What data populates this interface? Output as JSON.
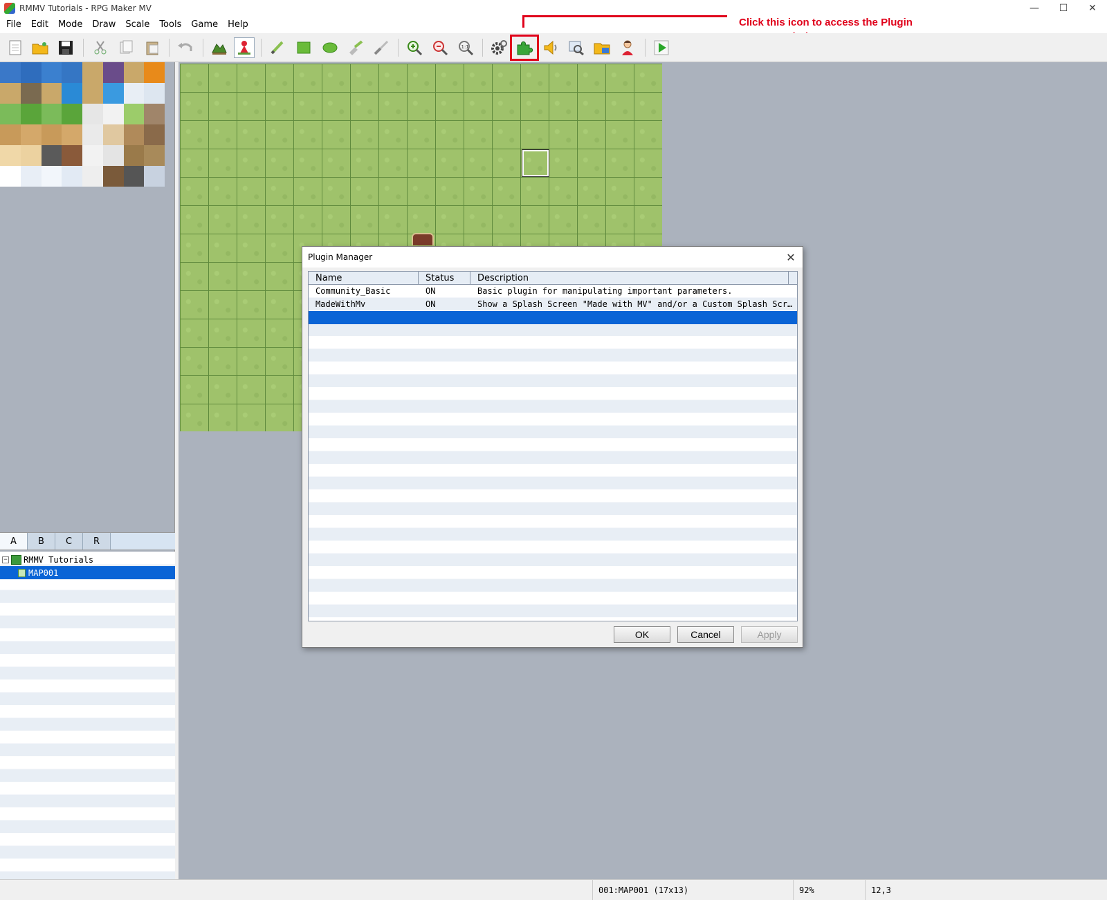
{
  "window": {
    "title": "RMMV Tutorials - RPG Maker MV",
    "minimize": "—",
    "maximize": "☐",
    "close": "✕"
  },
  "menu": [
    {
      "label": "File"
    },
    {
      "label": "Edit"
    },
    {
      "label": "Mode"
    },
    {
      "label": "Draw"
    },
    {
      "label": "Scale"
    },
    {
      "label": "Tools"
    },
    {
      "label": "Game"
    },
    {
      "label": "Help"
    }
  ],
  "annotation": {
    "text": "Click this icon to access the Plugin Manager window",
    "color": "#e0001a"
  },
  "tileset_tabs": [
    {
      "label": "A"
    },
    {
      "label": "B"
    },
    {
      "label": "C"
    },
    {
      "label": "R"
    }
  ],
  "map_tree": {
    "project": "RMMV Tutorials",
    "map": "MAP001"
  },
  "status": {
    "map_info": "001:MAP001 (17x13)",
    "zoom": "92%",
    "coords": "12,3"
  },
  "plugin_manager": {
    "title": "Plugin Manager",
    "columns": {
      "name": "Name",
      "status": "Status",
      "description": "Description"
    },
    "rows": [
      {
        "name": "Community_Basic",
        "status": "ON",
        "description": "Basic plugin for manipulating important parameters."
      },
      {
        "name": "MadeWithMv",
        "status": "ON",
        "description": "Show a Splash Screen \"Made with MV\" and/or a Custom Splash Screen be…"
      }
    ],
    "buttons": {
      "ok": "OK",
      "cancel": "Cancel",
      "apply": "Apply"
    }
  },
  "colors": {
    "selection": "#0a64d6",
    "grass": "#9fc26b",
    "workspace": "#abb2bd"
  }
}
